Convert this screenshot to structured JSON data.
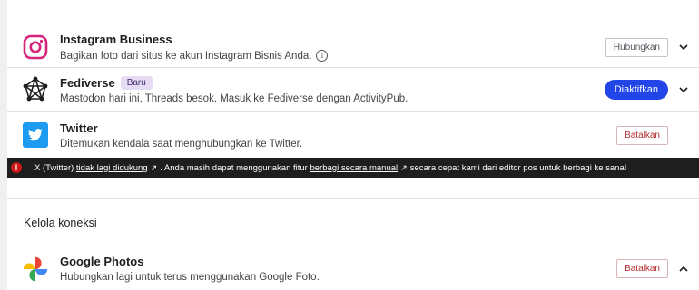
{
  "connections": [
    {
      "name": "Instagram Business",
      "description": "Bagikan foto dari situs ke akun Instagram Bisnis Anda.",
      "action_label": "Hubungkan",
      "icon": "instagram-icon"
    },
    {
      "name": "Fediverse",
      "badge": "Baru",
      "description": "Mastodon hari ini, Threads besok. Masuk ke Fediverse dengan ActivityPub.",
      "action_label": "Diaktifkan",
      "icon": "fediverse-icon"
    },
    {
      "name": "Twitter",
      "description": "Ditemukan kendala saat menghubungkan ke Twitter.",
      "action_label": "Batalkan",
      "icon": "twitter-icon"
    }
  ],
  "notice": {
    "prefix": "X (Twitter)",
    "link1": "tidak lagi didukung",
    "middle": ". Anda masih dapat menggunakan fitur",
    "link2": "berbagi secara manual",
    "suffix": "secara cepat kami dari editor pos untuk berbagi ke sana!"
  },
  "manage": {
    "heading": "Kelola koneksi",
    "connection": {
      "name": "Google Photos",
      "description": "Hubungkan lagi untuk terus menggunakan Google Foto.",
      "action_label": "Batalkan",
      "icon": "google-photos-icon"
    }
  },
  "colors": {
    "primary": "#2145e6",
    "danger": "#b32d2e",
    "notice_bg": "#1e1e1e",
    "badge_bg": "#e6ddf5"
  }
}
